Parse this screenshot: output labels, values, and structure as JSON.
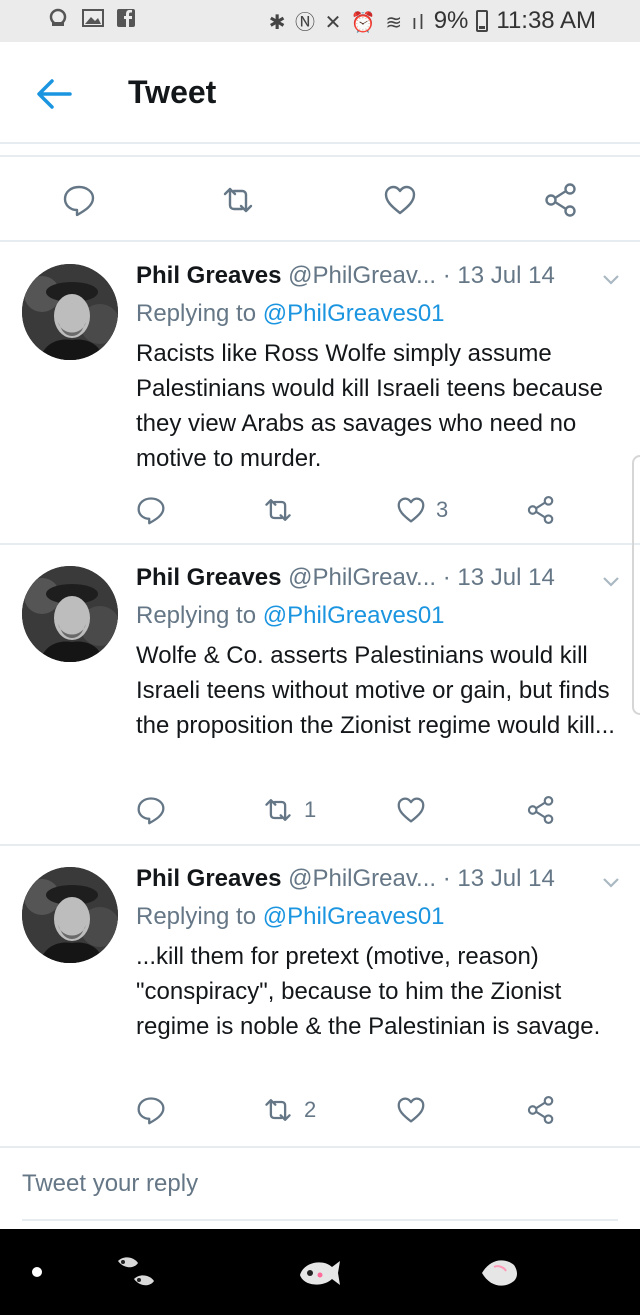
{
  "status_bar": {
    "battery": "9%",
    "time": "11:38 AM"
  },
  "header": {
    "title": "Tweet"
  },
  "tweets": [
    {
      "name": "Phil Greaves",
      "handle": "@PhilGreav...",
      "date": "· 13 Jul 14",
      "replying_prefix": "Replying to",
      "replying_to": "@PhilGreaves01",
      "text": "Racists like Ross Wolfe simply assume Palestinians would kill Israeli teens because they view Arabs as savages who need no motive to murder.",
      "retweets": "",
      "likes": "3"
    },
    {
      "name": "Phil Greaves",
      "handle": "@PhilGreav...",
      "date": "· 13 Jul 14",
      "replying_prefix": "Replying to",
      "replying_to": "@PhilGreaves01",
      "text": "Wolfe & Co. asserts Palestinians would kill Israeli teens without motive or gain, but finds the proposition the Zionist regime would kill...",
      "retweets": "1",
      "likes": ""
    },
    {
      "name": "Phil Greaves",
      "handle": "@PhilGreav...",
      "date": "· 13 Jul 14",
      "replying_prefix": "Replying to",
      "replying_to": "@PhilGreaves01",
      "text": "...kill them for pretext (motive, reason) \"conspiracy\", because to him the Zionist regime is noble & the Palestinian is savage.",
      "retweets": "2",
      "likes": ""
    }
  ],
  "reply_box": {
    "placeholder": "Tweet your reply"
  },
  "colors": {
    "accent": "#1b95e0",
    "muted": "#657786",
    "divider": "#e6ecf0"
  }
}
